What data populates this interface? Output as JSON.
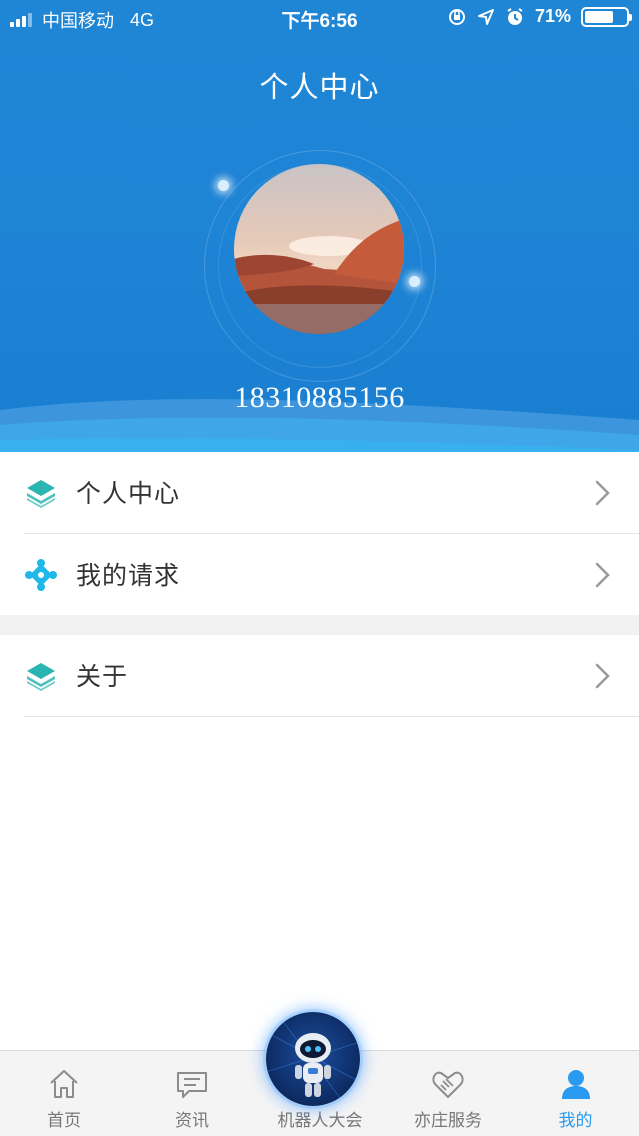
{
  "status_bar": {
    "carrier": "中国移动",
    "network": "4G",
    "time": "下午6:56",
    "battery_percent": "71%",
    "battery_level": 0.71
  },
  "header": {
    "title": "个人中心",
    "phone_number": "18310885156"
  },
  "menu": {
    "items": [
      {
        "label": "个人中心",
        "icon": "layers-icon"
      },
      {
        "label": "我的请求",
        "icon": "cross-star-icon"
      },
      {
        "label": "关于",
        "icon": "layers-icon"
      }
    ]
  },
  "tabbar": {
    "tabs": [
      {
        "label": "首页",
        "icon": "home-icon"
      },
      {
        "label": "资讯",
        "icon": "chat-icon"
      },
      {
        "label": "机器人大会",
        "icon": "robot-icon"
      },
      {
        "label": "亦庄服务",
        "icon": "handshake-icon"
      },
      {
        "label": "我的",
        "icon": "user-icon"
      }
    ],
    "active_index": 4
  },
  "colors": {
    "header_blue": "#1f86d6",
    "accent_teal": "#2bb5b0",
    "active_tab": "#2a9bf0"
  }
}
